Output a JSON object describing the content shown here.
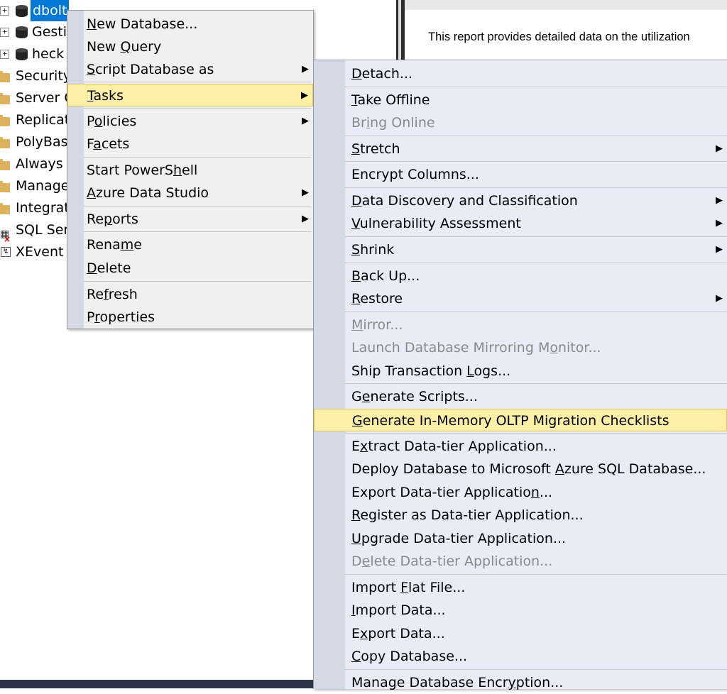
{
  "tree": {
    "databases": [
      {
        "label": "dbolt",
        "selected": true
      },
      {
        "label": "Gesti"
      },
      {
        "label": "heck"
      }
    ],
    "folders": [
      "Security",
      "Server O",
      "Replicat",
      "PolyBas",
      "Always",
      "Manage",
      "Integrat"
    ],
    "agent": "SQL Ser",
    "xevent": "XEvent"
  },
  "report": {
    "intro": "This report provides detailed data on the utilization"
  },
  "context_menu": {
    "items": [
      {
        "pre": "",
        "u": "N",
        "post": "ew Database...",
        "submenu": false
      },
      {
        "pre": "New ",
        "u": "Q",
        "post": "uery",
        "submenu": false
      },
      {
        "pre": "",
        "u": "S",
        "post": "cript Database as",
        "submenu": true
      },
      {
        "pre": "",
        "u": "T",
        "post": "asks",
        "submenu": true,
        "highlighted": true
      },
      {
        "pre": "P",
        "u": "o",
        "post": "licies",
        "submenu": true
      },
      {
        "pre": "F",
        "u": "a",
        "post": "cets",
        "submenu": false
      },
      {
        "pre": "Start PowerS",
        "u": "h",
        "post": "ell",
        "submenu": false
      },
      {
        "pre": "",
        "u": "A",
        "post": "zure Data Studio",
        "submenu": true
      },
      {
        "pre": "Re",
        "u": "p",
        "post": "orts",
        "submenu": true
      },
      {
        "pre": "Rena",
        "u": "m",
        "post": "e",
        "submenu": false
      },
      {
        "pre": "",
        "u": "D",
        "post": "elete",
        "submenu": false
      },
      {
        "pre": "Re",
        "u": "f",
        "post": "resh",
        "submenu": false
      },
      {
        "pre": "P",
        "u": "r",
        "post": "operties",
        "submenu": false
      }
    ]
  },
  "tasks_menu": {
    "items": [
      {
        "pre": "",
        "u": "D",
        "post": "etach...",
        "submenu": false
      },
      {
        "pre": "",
        "u": "T",
        "post": "ake Offline",
        "submenu": false
      },
      {
        "pre": "Br",
        "u": "i",
        "post": "ng Online",
        "submenu": false,
        "disabled": true
      },
      {
        "pre": "",
        "u": "S",
        "post": "tretch",
        "submenu": true
      },
      {
        "pre": "Encrypt Columns...",
        "u": "",
        "post": "",
        "submenu": false
      },
      {
        "pre": "",
        "u": "D",
        "post": "ata Discovery and Classification",
        "submenu": true
      },
      {
        "pre": "",
        "u": "V",
        "post": "ulnerability Assessment",
        "submenu": true
      },
      {
        "pre": "",
        "u": "S",
        "post": "hrink",
        "submenu": true
      },
      {
        "pre": "",
        "u": "B",
        "post": "ack Up...",
        "submenu": false
      },
      {
        "pre": "",
        "u": "R",
        "post": "estore",
        "submenu": true
      },
      {
        "pre": "",
        "u": "M",
        "post": "irror...",
        "submenu": false,
        "disabled": true
      },
      {
        "pre": "Launch Database Mirroring M",
        "u": "o",
        "post": "nitor...",
        "submenu": false,
        "disabled": true
      },
      {
        "pre": "Ship Transaction ",
        "u": "L",
        "post": "ogs...",
        "submenu": false
      },
      {
        "pre": "G",
        "u": "e",
        "post": "nerate Scripts...",
        "submenu": false
      },
      {
        "pre": "",
        "u": "G",
        "post": "enerate In-Memory OLTP Migration Checklists",
        "submenu": false,
        "highlighted": true
      },
      {
        "pre": "E",
        "u": "x",
        "post": "tract Data-tier Application...",
        "submenu": false
      },
      {
        "pre": "Deploy Database to Microsoft ",
        "u": "A",
        "post": "zure SQL Database...",
        "submenu": false
      },
      {
        "pre": "Export Data-tier Applicatio",
        "u": "n",
        "post": "...",
        "submenu": false
      },
      {
        "pre": "",
        "u": "R",
        "post": "egister as Data-tier Application...",
        "submenu": false
      },
      {
        "pre": "",
        "u": "U",
        "post": "pgrade Data-tier Application...",
        "submenu": false
      },
      {
        "pre": "D",
        "u": "e",
        "post": "lete Data-tier Application...",
        "submenu": false,
        "disabled": true
      },
      {
        "pre": "Import ",
        "u": "F",
        "post": "lat File...",
        "submenu": false
      },
      {
        "pre": "",
        "u": "I",
        "post": "mport Data...",
        "submenu": false
      },
      {
        "pre": "E",
        "u": "x",
        "post": "port Data...",
        "submenu": false
      },
      {
        "pre": "",
        "u": "C",
        "post": "opy Database...",
        "submenu": false
      },
      {
        "pre": "Manage Database Encr",
        "u": "y",
        "post": "ption...",
        "submenu": false
      }
    ]
  },
  "icons": {
    "submenu_arrow": "triangle-right-icon",
    "expand": "plus-expander-icon"
  }
}
